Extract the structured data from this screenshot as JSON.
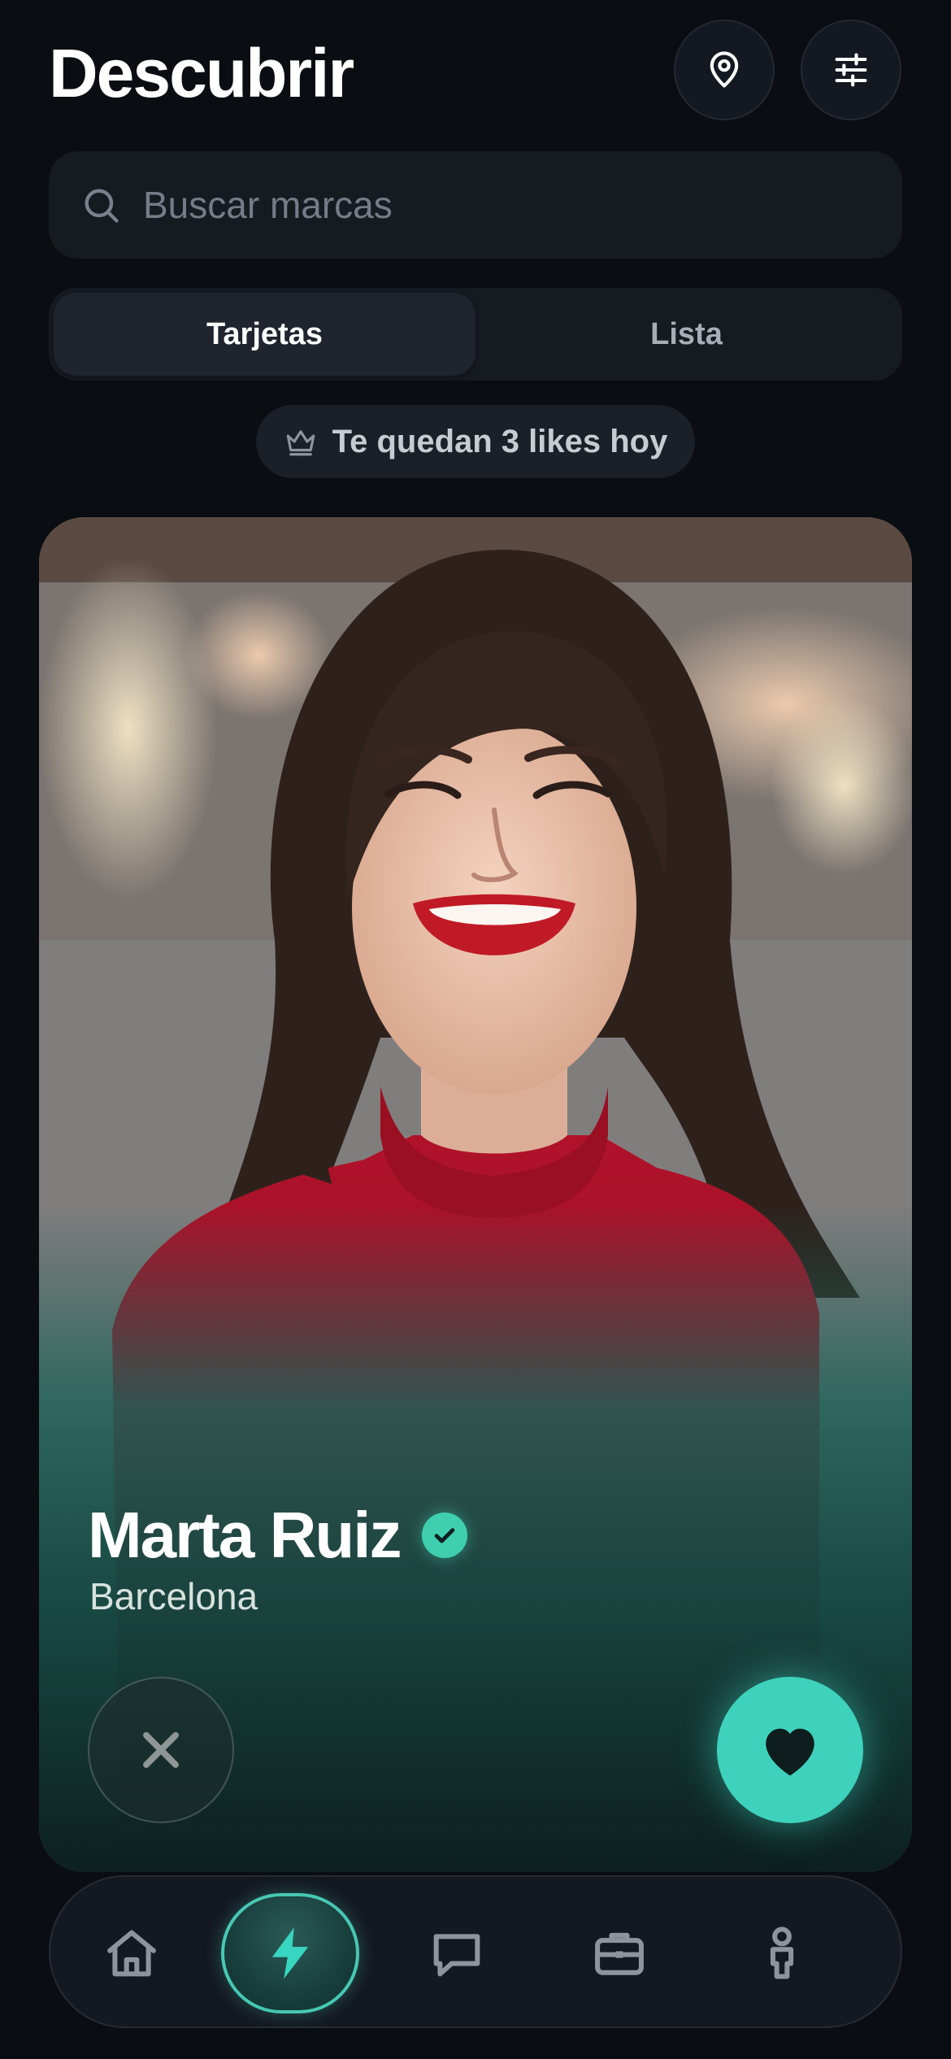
{
  "header": {
    "title": "Descubrir",
    "location_icon": "location-pin-icon",
    "filter_icon": "sliders-icon"
  },
  "search": {
    "placeholder": "Buscar marcas",
    "value": ""
  },
  "tabs": [
    {
      "label": "Tarjetas",
      "active": true
    },
    {
      "label": "Lista",
      "active": false
    }
  ],
  "likes_banner": {
    "icon": "crown-icon",
    "text": "Te quedan 3 likes hoy"
  },
  "card": {
    "name": "Marta Ruiz",
    "city": "Barcelona",
    "verified": true,
    "pass_icon": "close-icon",
    "like_icon": "heart-icon"
  },
  "bottom_nav": [
    {
      "icon": "home-icon",
      "active": false
    },
    {
      "icon": "lightning-icon",
      "active": true
    },
    {
      "icon": "chat-icon",
      "active": false
    },
    {
      "icon": "briefcase-icon",
      "active": false
    },
    {
      "icon": "person-icon",
      "active": false
    }
  ],
  "colors": {
    "background": "#0a0d12",
    "accent": "#3ed2bd",
    "surface": "#161a21",
    "muted_text": "#757c88"
  }
}
